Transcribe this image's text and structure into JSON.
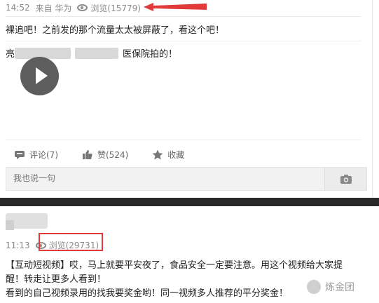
{
  "post1": {
    "time": "14:52",
    "source": "来自 华为",
    "views_label": "浏览(15779)",
    "line1": "裸追吧！之前发的那个流量太太被屏蔽了，看这个吧！",
    "line2_prefix": "亮",
    "line2_tail": "医保院拍的！",
    "comment_label": "评论(7)",
    "like_label": "赞(524)",
    "fav_label": "收藏",
    "comment_placeholder": "我也说一句"
  },
  "post2": {
    "time": "11:13",
    "views_label": "浏览(29731)",
    "body_lines": [
      "【互动短视频】哎，马上就要平安夜了，食品安全一定要注意。用这个视频给大家提",
      "醒！转走让更多人看到！",
      "看到的自己视频录用的找我要奖金哟！同一视频多人推荐的平分奖金！"
    ]
  },
  "watermark": {
    "text": "炼金团"
  },
  "colors": {
    "annotation_red": "#e03a3a",
    "meta_gray": "#8a8a8a"
  },
  "icons": [
    "eye-icon",
    "play-icon",
    "comment-icon",
    "thumbs-up-icon",
    "star-icon",
    "camera-icon"
  ]
}
